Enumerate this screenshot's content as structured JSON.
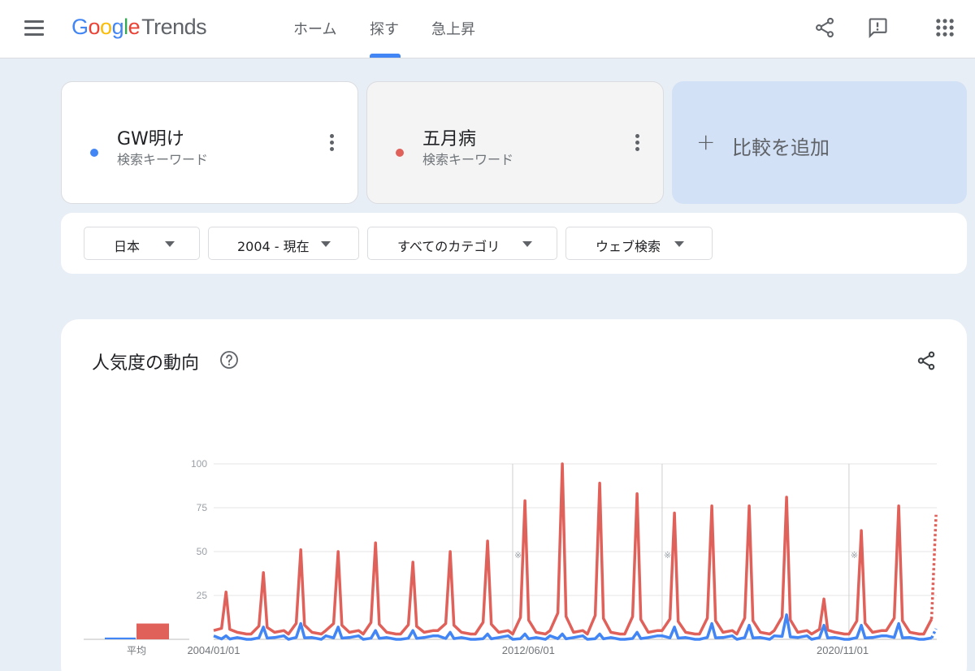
{
  "header": {
    "logo_parts": [
      "G",
      "o",
      "o",
      "g",
      "l",
      "e"
    ],
    "logo_product": "Trends",
    "tabs": [
      {
        "label": "ホーム"
      },
      {
        "label": "探す"
      },
      {
        "label": "急上昇"
      }
    ],
    "active_tab": "探す"
  },
  "keywords": [
    {
      "term": "GW明け",
      "subtitle": "検索キーワード",
      "color": "#4285f4"
    },
    {
      "term": "五月病",
      "subtitle": "検索キーワード",
      "color": "#e0605a"
    }
  ],
  "add_compare": {
    "plus": "+",
    "label": "比較を追加"
  },
  "filters": [
    {
      "label": "日本"
    },
    {
      "label": "2004 - 現在"
    },
    {
      "label": "すべてのカテゴリ"
    },
    {
      "label": "ウェブ検索"
    }
  ],
  "panel": {
    "title": "人気度の動向",
    "average_label": "平均"
  },
  "chart_data": {
    "type": "line",
    "title": "人気度の動向",
    "ylim": [
      0,
      100
    ],
    "y_ticks": [
      "100",
      "75",
      "50",
      "25"
    ],
    "x_tick_labels": [
      "2004/01/01",
      "2012/06/01",
      "2020/11/01"
    ],
    "note_marker": "※",
    "averages": [
      {
        "name": "GW明け",
        "value": 1,
        "color": "#4285f4"
      },
      {
        "name": "五月病",
        "value": 9,
        "color": "#e0605a"
      }
    ],
    "series": [
      {
        "name": "五月病",
        "color": "#e0605a",
        "peaks": [
          {
            "year": 2004,
            "value": 27
          },
          {
            "year": 2005,
            "value": 38
          },
          {
            "year": 2006,
            "value": 51
          },
          {
            "year": 2007,
            "value": 50
          },
          {
            "year": 2008,
            "value": 55
          },
          {
            "year": 2009,
            "value": 44
          },
          {
            "year": 2010,
            "value": 50
          },
          {
            "year": 2011,
            "value": 56
          },
          {
            "year": 2012,
            "value": 79
          },
          {
            "year": 2013,
            "value": 100
          },
          {
            "year": 2014,
            "value": 89
          },
          {
            "year": 2015,
            "value": 83
          },
          {
            "year": 2016,
            "value": 72
          },
          {
            "year": 2017,
            "value": 76
          },
          {
            "year": 2018,
            "value": 76
          },
          {
            "year": 2019,
            "value": 81
          },
          {
            "year": 2020,
            "value": 23
          },
          {
            "year": 2021,
            "value": 62
          },
          {
            "year": 2022,
            "value": 76
          },
          {
            "year": 2023,
            "value": 71
          }
        ],
        "baseline": 3
      },
      {
        "name": "GW明け",
        "color": "#4285f4",
        "peaks": [
          {
            "year": 2004,
            "value": 2
          },
          {
            "year": 2005,
            "value": 7
          },
          {
            "year": 2006,
            "value": 9
          },
          {
            "year": 2007,
            "value": 7
          },
          {
            "year": 2008,
            "value": 5
          },
          {
            "year": 2009,
            "value": 5
          },
          {
            "year": 2010,
            "value": 4
          },
          {
            "year": 2011,
            "value": 3
          },
          {
            "year": 2012,
            "value": 3
          },
          {
            "year": 2013,
            "value": 3
          },
          {
            "year": 2014,
            "value": 3
          },
          {
            "year": 2015,
            "value": 4
          },
          {
            "year": 2016,
            "value": 7
          },
          {
            "year": 2017,
            "value": 9
          },
          {
            "year": 2018,
            "value": 8
          },
          {
            "year": 2019,
            "value": 14
          },
          {
            "year": 2020,
            "value": 8
          },
          {
            "year": 2021,
            "value": 8
          },
          {
            "year": 2022,
            "value": 9
          },
          {
            "year": 2023,
            "value": 6
          }
        ],
        "baseline": 0
      }
    ]
  }
}
